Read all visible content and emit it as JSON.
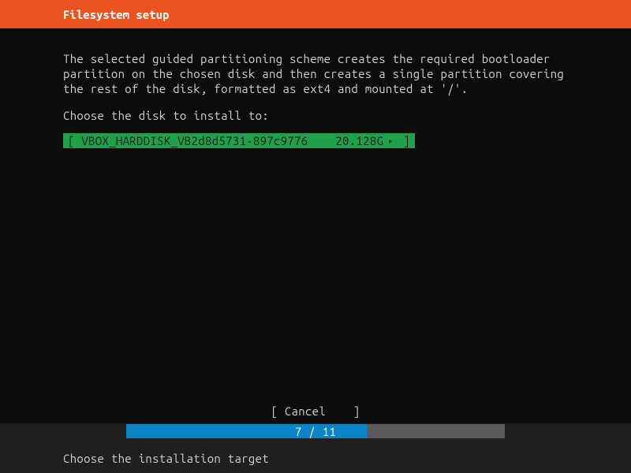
{
  "header": {
    "title": "Filesystem setup"
  },
  "main": {
    "description": "The selected guided partitioning scheme creates the required bootloader partition on the chosen disk and then creates a single partition covering the rest of the disk, formatted as ext4 and mounted at '/'.",
    "prompt": "Choose the disk to install to:",
    "disk": {
      "open_bracket": "[ ",
      "name": "VBOX_HARDDISK_VB2d8d5731-897c9776",
      "size": "20.128G",
      "arrow": "▸",
      "close_bracket": " ]"
    }
  },
  "footer": {
    "cancel": "[ Cancel    ]",
    "progress_text": "7 / 11",
    "progress_percent": 63.6,
    "hint": "Choose the installation target"
  }
}
